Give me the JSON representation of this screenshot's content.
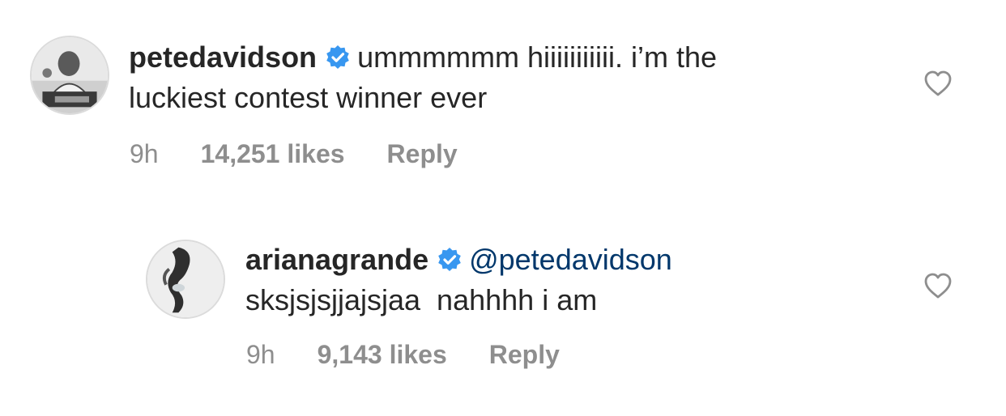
{
  "comments": [
    {
      "username": "petedavidson",
      "verified_icon": "verified-badge-icon",
      "text_line1": "ummmmmm hiiiiiiiiiii. i’m the",
      "text_line2": "luckiest contest winner ever",
      "time": "9h",
      "likes": "14,251 likes",
      "reply": "Reply",
      "like_icon": "heart-outline-icon"
    },
    {
      "username": "arianagrande",
      "verified_icon": "verified-badge-icon",
      "mention": "@petedavidson",
      "text_line2": "sksjsjsjjajsjaa  nahhhh i am",
      "time": "9h",
      "likes": "9,143 likes",
      "reply": "Reply",
      "like_icon": "heart-outline-icon"
    }
  ],
  "colors": {
    "text": "#262626",
    "meta": "#8e8e8e",
    "mention": "#00376b",
    "verified": "#3897f0"
  }
}
